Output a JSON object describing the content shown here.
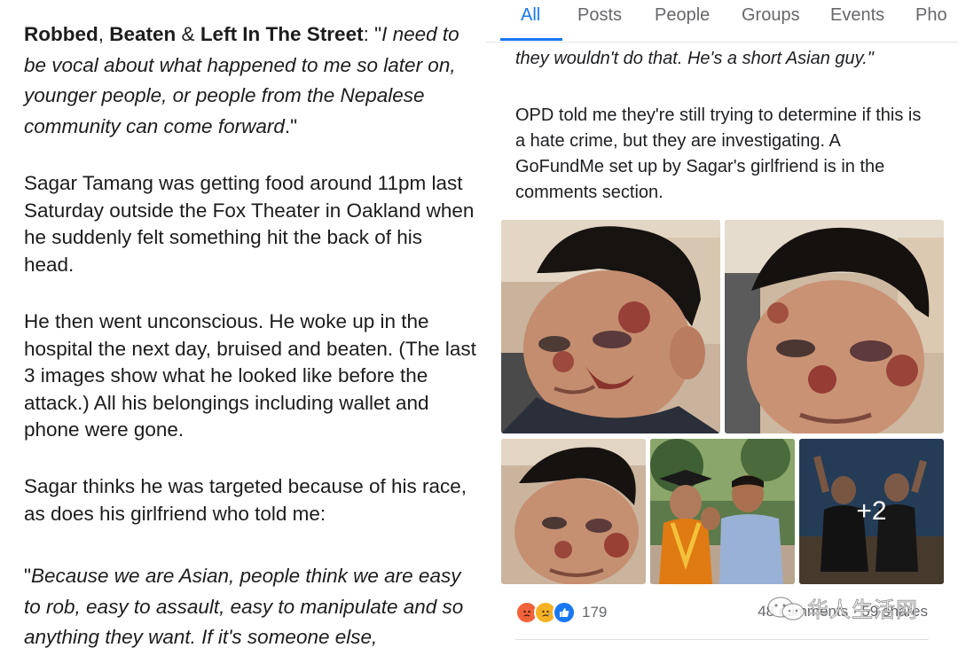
{
  "left_panel": {
    "p1": {
      "b1": "Robbed",
      "c1": ", ",
      "b2": "Beaten",
      "c2": " & ",
      "b3": "Left In The Street",
      "c3": ": \"",
      "quote": "I need to be vocal about what happened to me so later on, younger people, or people from the Nepalese community can come forward",
      "close": ".\""
    },
    "p2": "Sagar Tamang was getting food around 11pm last Saturday outside the Fox Theater in Oakland when he suddenly felt something hit the back of his head.",
    "p3": "He then went unconscious. He woke up in the hospital the next day, bruised and beaten. (The last 3 images show what he looked like before the attack.) All his belongings including wallet and phone were gone.",
    "p4": "Sagar thinks he was targeted because of his race, as does his girlfriend who told me:",
    "p5": {
      "open": "\"",
      "quote": "Because we are Asian, people think we are easy to rob, easy to assault, easy to manipulate and so anything they want. If it's someone else,"
    }
  },
  "right_panel": {
    "tabs": [
      {
        "label": "All",
        "active": true
      },
      {
        "label": "Posts",
        "active": false
      },
      {
        "label": "People",
        "active": false
      },
      {
        "label": "Groups",
        "active": false
      },
      {
        "label": "Events",
        "active": false
      },
      {
        "label": "Pho",
        "active": false
      }
    ],
    "quote_tail": {
      "quote": "they wouldn't do that. He's a short Asian guy",
      "close": ".\""
    },
    "body_text": "OPD told me they're still trying to determine if this is a hate crime, but they are investigating. A GoFundMe set up by Sagar's girlfriend is in the comments section.",
    "photo_overlay": "+2",
    "reactions": {
      "icons": [
        "angry-icon",
        "sad-icon",
        "like-icon"
      ],
      "count": "179"
    },
    "comments_shares": "48 comments · 59 shares",
    "watermark": "华人生活网",
    "colors": {
      "accent": "#1877f2",
      "secondary_text": "#65676b",
      "angry": "#f0623a",
      "sad": "#f7b125",
      "like": "#1877f2"
    }
  }
}
